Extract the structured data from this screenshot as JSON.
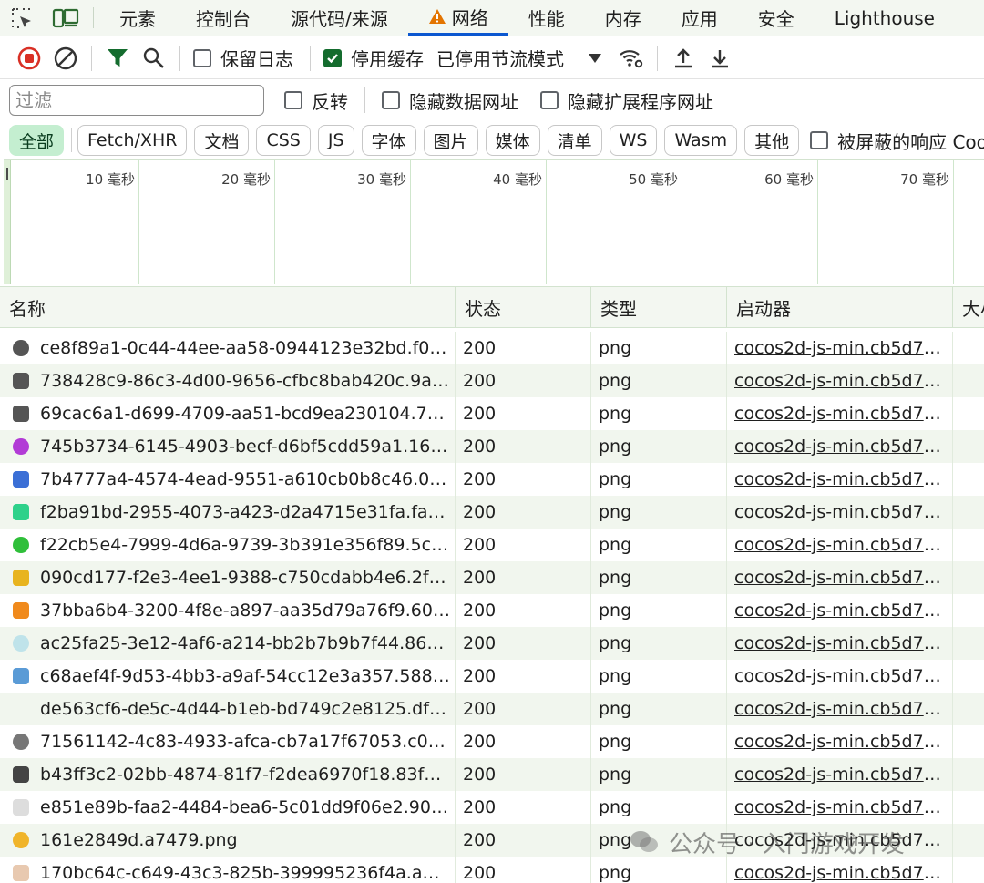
{
  "tabs": [
    {
      "label": "元素"
    },
    {
      "label": "控制台"
    },
    {
      "label": "源代码/来源"
    },
    {
      "label": "网络",
      "active": true,
      "warning": true
    },
    {
      "label": "性能"
    },
    {
      "label": "内存"
    },
    {
      "label": "应用"
    },
    {
      "label": "安全"
    },
    {
      "label": "Lighthouse"
    }
  ],
  "toolbar": {
    "preserve_log": "保留日志",
    "disable_cache": "停用缓存",
    "throttle": "已停用节流模式"
  },
  "filter": {
    "placeholder": "过滤",
    "invert": "反转",
    "hide_data_urls": "隐藏数据网址",
    "hide_ext_urls": "隐藏扩展程序网址"
  },
  "chips": [
    "全部",
    "Fetch/XHR",
    "文档",
    "CSS",
    "JS",
    "字体",
    "图片",
    "媒体",
    "清单",
    "WS",
    "Wasm",
    "其他"
  ],
  "blocked_cookies": "被屏蔽的响应 Cookie",
  "timeline_labels": [
    "10 毫秒",
    "20 毫秒",
    "30 毫秒",
    "40 毫秒",
    "50 毫秒",
    "60 毫秒",
    "70 毫秒"
  ],
  "columns": {
    "name": "名称",
    "status": "状态",
    "type": "类型",
    "initiator": "启动器",
    "size": "大小"
  },
  "rows": [
    {
      "name": "ce8f89a1-0c44-44ee-aa58-0944123e32bd.f020a...",
      "status": "200",
      "type": "png",
      "initiator": "cocos2d-js-min.cb5d7.j...",
      "thumb": "#555555"
    },
    {
      "name": "738428c9-86c3-4d00-9656-cfbc8bab420c.9a19...",
      "status": "200",
      "type": "png",
      "initiator": "cocos2d-js-min.cb5d7.j...",
      "thumb": "#555555"
    },
    {
      "name": "69cac6a1-d699-4709-aa51-bcd9ea230104.7926...",
      "status": "200",
      "type": "png",
      "initiator": "cocos2d-js-min.cb5d7.j...",
      "thumb": "#555555"
    },
    {
      "name": "745b3734-6145-4903-becf-d6bf5cdd59a1.165c...",
      "status": "200",
      "type": "png",
      "initiator": "cocos2d-js-min.cb5d7.j...",
      "thumb": "#b23bd6"
    },
    {
      "name": "7b4777a4-4574-4ead-9551-a610cb0b8c46.03b...",
      "status": "200",
      "type": "png",
      "initiator": "cocos2d-js-min.cb5d7.j...",
      "thumb": "#3b6fd6"
    },
    {
      "name": "f2ba91bd-2955-4073-a423-d2a4715e31fa.fa6f3....",
      "status": "200",
      "type": "png",
      "initiator": "cocos2d-js-min.cb5d7.j...",
      "thumb": "#2ed18a"
    },
    {
      "name": "f22cb5e4-7999-4d6a-9739-3b391e356f89.5c13...",
      "status": "200",
      "type": "png",
      "initiator": "cocos2d-js-min.cb5d7.j...",
      "thumb": "#2fbf3a"
    },
    {
      "name": "090cd177-f2e3-4ee1-9388-c750cdabb4e6.2f4f8...",
      "status": "200",
      "type": "png",
      "initiator": "cocos2d-js-min.cb5d7.j...",
      "thumb": "#e8b41f"
    },
    {
      "name": "37bba6b4-3200-4f8e-a897-aa35d79a76f9.60ac...",
      "status": "200",
      "type": "png",
      "initiator": "cocos2d-js-min.cb5d7.j...",
      "thumb": "#f08a1c"
    },
    {
      "name": "ac25fa25-3e12-4af6-a214-bb2b7b9b7f44.861f9....",
      "status": "200",
      "type": "png",
      "initiator": "cocos2d-js-min.cb5d7.j...",
      "thumb": "#bfe3ea"
    },
    {
      "name": "c68aef4f-9d53-4bb3-a9af-54cc12e3a357.58879....",
      "status": "200",
      "type": "png",
      "initiator": "cocos2d-js-min.cb5d7.j...",
      "thumb": "#5a9bd6"
    },
    {
      "name": "de563cf6-de5c-4d44-b1eb-bd749c2e8125.df05...",
      "status": "200",
      "type": "png",
      "initiator": "cocos2d-js-min.cb5d7.j...",
      "thumb": "#ffffff"
    },
    {
      "name": "71561142-4c83-4933-afca-cb7a17f67053.c06a9...",
      "status": "200",
      "type": "png",
      "initiator": "cocos2d-js-min.cb5d7.j...",
      "thumb": "#777777"
    },
    {
      "name": "b43ff3c2-02bb-4874-81f7-f2dea6970f18.83fcc....",
      "status": "200",
      "type": "png",
      "initiator": "cocos2d-js-min.cb5d7.j...",
      "thumb": "#444444"
    },
    {
      "name": "e851e89b-faa2-4484-bea6-5c01dd9f06e2.90cf4...",
      "status": "200",
      "type": "png",
      "initiator": "cocos2d-js-min.cb5d7.j...",
      "thumb": "#dddddd"
    },
    {
      "name": "161e2849d.a7479.png",
      "status": "200",
      "type": "png",
      "initiator": "cocos2d-js-min.cb5d7.j...",
      "thumb": "#f0b42a"
    },
    {
      "name": "170bc64c-c649-43c3-825b-399995236f4a.a2a5...",
      "status": "200",
      "type": "png",
      "initiator": "cocos2d-js-min.cb5d7.j...",
      "thumb": "#e8c9b0"
    }
  ],
  "watermark": "公众号 · 入门游戏开发",
  "colors": {
    "accent": "#0b57d0",
    "record_red": "#d93025",
    "active_chip": "#c4eed0",
    "checkbox_on": "#146c2e"
  }
}
